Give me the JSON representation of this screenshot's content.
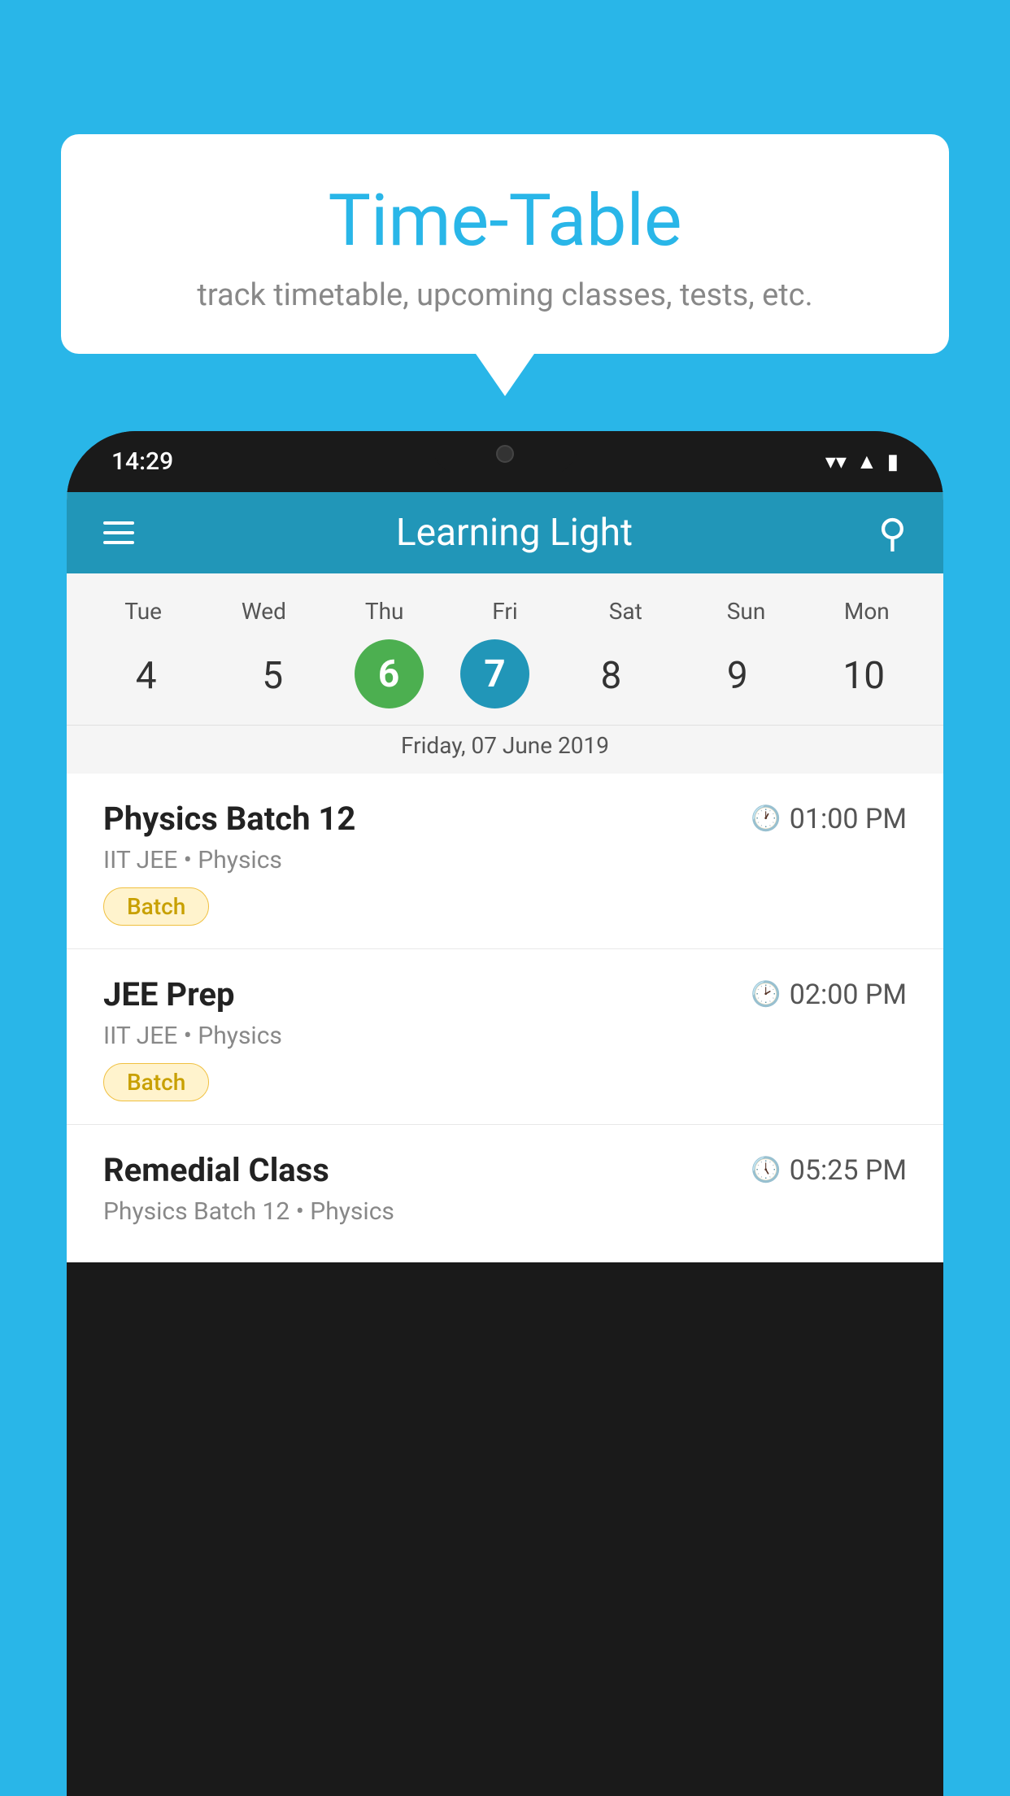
{
  "background_color": "#29b6e8",
  "tooltip": {
    "title": "Time-Table",
    "subtitle": "track timetable, upcoming classes, tests, etc."
  },
  "phone": {
    "status_bar": {
      "time": "14:29"
    },
    "app_header": {
      "title": "Learning Light"
    },
    "calendar": {
      "days": [
        "Tue",
        "Wed",
        "Thu",
        "Fri",
        "Sat",
        "Sun",
        "Mon"
      ],
      "dates": [
        "4",
        "5",
        "6",
        "7",
        "8",
        "9",
        "10"
      ],
      "today_index": 2,
      "selected_index": 3,
      "date_label": "Friday, 07 June 2019"
    },
    "schedule_items": [
      {
        "title": "Physics Batch 12",
        "time": "01:00 PM",
        "subtitle": "IIT JEE • Physics",
        "tag": "Batch"
      },
      {
        "title": "JEE Prep",
        "time": "02:00 PM",
        "subtitle": "IIT JEE • Physics",
        "tag": "Batch"
      },
      {
        "title": "Remedial Class",
        "time": "05:25 PM",
        "subtitle": "Physics Batch 12 • Physics",
        "tag": ""
      }
    ]
  }
}
